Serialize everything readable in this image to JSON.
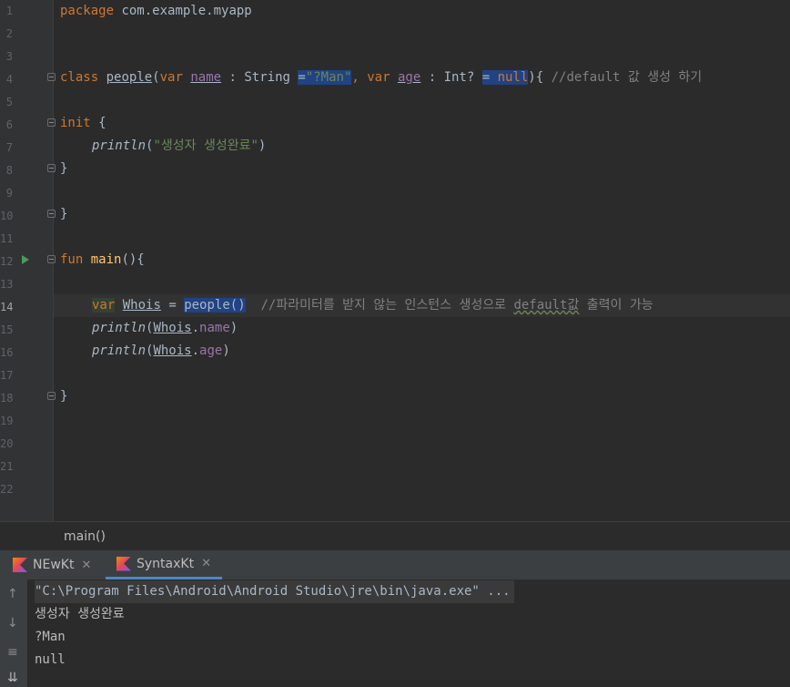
{
  "editor": {
    "line_numbers": [
      "1",
      "2",
      "3",
      "4",
      "5",
      "6",
      "7",
      "8",
      "9",
      "10",
      "11",
      "12",
      "13",
      "14",
      "15",
      "16",
      "17",
      "18",
      "19",
      "20",
      "21",
      "22"
    ],
    "l1": {
      "kw": "package",
      "rest": " com.example.myapp"
    },
    "l4": {
      "class_kw": "class",
      "name": "people",
      "p1": "(",
      "var1": "var",
      "name_param": "name",
      "colon1": " : String ",
      "eq1": "=",
      "default1": "\"?Man\"",
      "comma": ",",
      "var2": "var",
      "age_param": "age",
      "colon2": " : Int? ",
      "eq2": "= ",
      "null": "null",
      "p2": "){ ",
      "comment": "//default 값 생성 하기"
    },
    "l6": {
      "kw": "init",
      "rest": " {"
    },
    "l7": {
      "fn": "println",
      "open": "(",
      "str": "\"생성자 생성완료\"",
      "close": ")"
    },
    "l8": "}",
    "l10": "}",
    "l12": {
      "kw": "fun",
      "fn": "main",
      "rest": "(){"
    },
    "l14": {
      "var": "var",
      "ident": "Whois",
      "eq": " = ",
      "call": "people()",
      "comment_a": "  //파라미터를 받지 않는 인스턴스 생성으로 ",
      "comment_b": "default값",
      "comment_c": " 출력이 가능"
    },
    "l15": {
      "fn": "println",
      "open": "(",
      "obj": "Whois",
      "dot": ".",
      "prop": "name",
      "close": ")"
    },
    "l16": {
      "fn": "println",
      "open": "(",
      "obj": "Whois",
      "dot": ".",
      "prop": "age",
      "close": ")"
    },
    "l18": "}"
  },
  "breadcrumb": "main()",
  "tabs": [
    {
      "label": "NEwKt",
      "close": "✕"
    },
    {
      "label": "SyntaxKt",
      "close": "✕"
    }
  ],
  "console": {
    "cmd": "\"C:\\Program Files\\Android\\Android Studio\\jre\\bin\\java.exe\" ...",
    "lines": [
      "생성자 생성완료",
      "?Man",
      "null"
    ]
  },
  "colors": {
    "keyword": "#cc7832",
    "string": "#6a8759",
    "comment": "#808080",
    "function": "#ffc66d",
    "property": "#9876aa",
    "selection": "#214283"
  }
}
